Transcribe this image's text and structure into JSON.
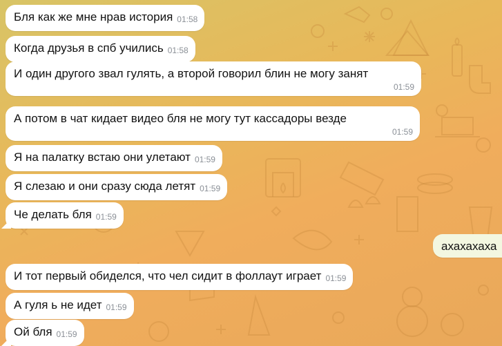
{
  "chat": {
    "accent_background": "#e9b25c",
    "messages": [
      {
        "text": "Бля как же мне нрав история",
        "time": "01:58"
      },
      {
        "text": "Когда друзья в спб учились",
        "time": "01:58"
      },
      {
        "text": "И один другого звал гулять, а второй говорил блин не могу занят",
        "time": "01:59"
      },
      {
        "text": "А потом в чат кидает видео бля не могу тут кассадоры везде",
        "time": "01:59"
      },
      {
        "text": "Я на палатку встаю они улетают",
        "time": "01:59"
      },
      {
        "text": "Я слезаю и они сразу сюда летят",
        "time": "01:59"
      },
      {
        "text": "Че делать бля",
        "time": "01:59"
      },
      {
        "text": "И тот первый обиделся, что чел сидит в фоллаут играет",
        "time": "01:59"
      },
      {
        "text": "А гуля ь не идет",
        "time": "01:59"
      },
      {
        "text": "Ой бля",
        "time": "01:59"
      }
    ],
    "outgoing": {
      "text": "ахахахаха"
    }
  }
}
